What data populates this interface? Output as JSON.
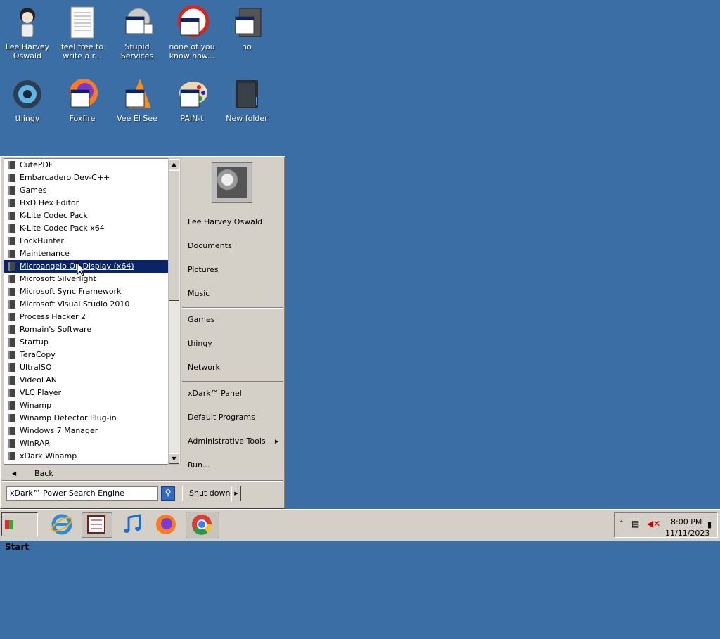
{
  "desktop": {
    "icons": [
      {
        "label": "Lee Harvey Oswald"
      },
      {
        "label": "feel free to write a r..."
      },
      {
        "label": "Stupid Services"
      },
      {
        "label": "none of you know how..."
      },
      {
        "label": "no"
      },
      {
        "label": "thingy"
      },
      {
        "label": "Foxfire"
      },
      {
        "label": "Vee El See"
      },
      {
        "label": "PAIN-t"
      },
      {
        "label": "New folder"
      }
    ]
  },
  "start_menu": {
    "programs": [
      "CutePDF",
      "Embarcadero Dev-C++",
      "Games",
      "HxD Hex Editor",
      "K-Lite Codec Pack",
      "K-Lite Codec Pack x64",
      "LockHunter",
      "Maintenance",
      "Microangelo On Display (x64)",
      "Microsoft Silverlight",
      "Microsoft Sync Framework",
      "Microsoft Visual Studio 2010",
      "Process Hacker 2",
      "Romain's Software",
      "Startup",
      "TeraCopy",
      "UltraISO",
      "VideoLAN",
      "VLC Player",
      "Winamp",
      "Winamp Detector Plug-in",
      "Windows 7 Manager",
      "WinRAR",
      "xDark Winamp"
    ],
    "selected_program": "Microangelo On Display (x64)",
    "back_label": "Back",
    "search_value": "xDark™ Power Search Engine",
    "shutdown_label": "Shut down",
    "right_items": {
      "user": "Lee Harvey Oswald",
      "documents": "Documents",
      "pictures": "Pictures",
      "music": "Music",
      "games": "Games",
      "thingy": "thingy",
      "network": "Network",
      "panel": "xDark™ Panel",
      "default_programs": "Default Programs",
      "admin_tools": "Administrative Tools",
      "run": "Run..."
    }
  },
  "taskbar": {
    "start_label": "Start",
    "clock_time": "8:00 PM",
    "clock_date": "11/11/2023"
  },
  "colors": {
    "desktop": "#3a6ea5",
    "selection": "#0a246a",
    "chrome": "#d4d0c8"
  }
}
